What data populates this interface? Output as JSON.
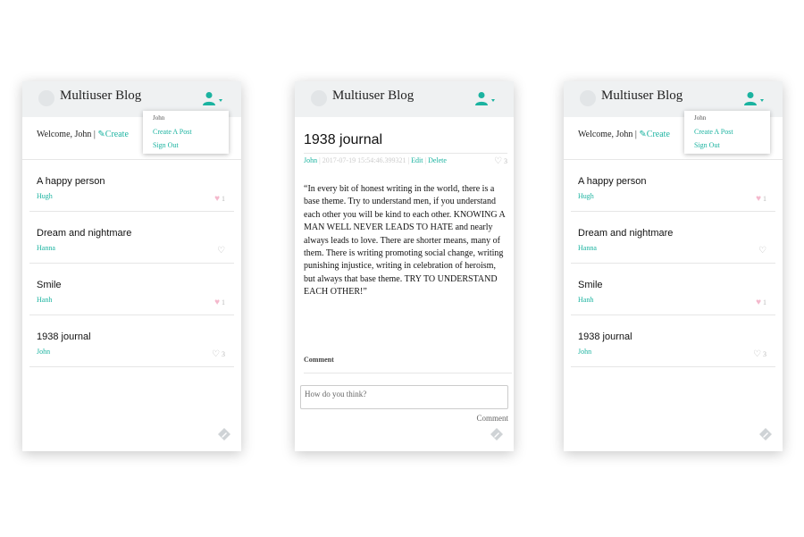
{
  "brand": "Multiuser Blog",
  "colors": {
    "accent": "#1bb3a0",
    "header_bg": "#eff1f2",
    "heart_liked": "#f4b8cc",
    "muted": "#bbbbbb"
  },
  "welcome": {
    "prefix": "Welcome, John |",
    "create_label": "Create"
  },
  "dropdown": {
    "user": "John",
    "create_post": "Create A Post",
    "sign_out": "Sign Out"
  },
  "posts": [
    {
      "title": "A happy person",
      "author": "Hugh",
      "likes": "1",
      "liked": true
    },
    {
      "title": "Dream and nightmare",
      "author": "Hanna",
      "likes": "",
      "liked": false
    },
    {
      "title": "Smile",
      "author": "Hanh",
      "likes": "1",
      "liked": true
    },
    {
      "title": "1938 journal",
      "author": "John",
      "likes": "3",
      "liked": false
    }
  ],
  "article": {
    "title": "1938 journal",
    "author": "John",
    "date": "2017-07-19 15:54:46.399321",
    "edit_label": "Edit",
    "delete_label": "Delete",
    "likes": "3",
    "body": "“In every bit of honest writing in the world, there is a base theme. Try to understand men, if you understand each other you will be kind to each other. KNOWING A MAN WELL NEVER LEADS TO HATE and nearly always leads to love. There are shorter means, many of them. There is writing promoting social change, writing punishing injustice, writing in celebration of heroism, but always that base theme. TRY TO UNDERSTAND EACH OTHER!”",
    "comment_heading": "Comment",
    "comment_placeholder": "How do you think?",
    "comment_button": "Comment"
  },
  "icons": {
    "logo": "logo-circle",
    "user": "user-icon",
    "pencil": "pencil-icon",
    "heart": "heart-icon",
    "fab": "edit-tag-icon"
  }
}
